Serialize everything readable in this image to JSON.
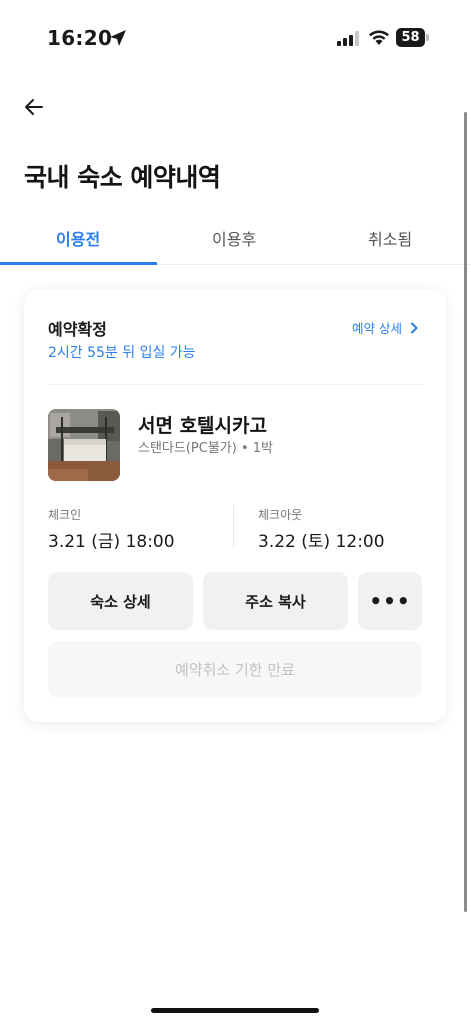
{
  "status_bar": {
    "time": "16:20",
    "battery": "58",
    "icons": [
      "location-arrow-icon",
      "signal-icon",
      "wifi-icon",
      "battery-icon"
    ]
  },
  "header": {
    "back_icon": "arrow-left-icon",
    "title": "국내 숙소 예약내역"
  },
  "tabs": [
    {
      "label": "이용전",
      "active": true
    },
    {
      "label": "이용후",
      "active": false
    },
    {
      "label": "취소됨",
      "active": false
    }
  ],
  "reservation": {
    "status": "예약확정",
    "time_remaining": "2시간 55분 뒤 입실 가능",
    "detail_link": "예약 상세",
    "hotel_name": "서면 호텔시카고",
    "room_info": "스탠다드(PC불가) • 1박",
    "checkin_label": "체크인",
    "checkin_value": "3.21 (금) 18:00",
    "checkout_label": "체크아웃",
    "checkout_value": "3.22 (토) 12:00",
    "buttons": {
      "detail": "숙소 상세",
      "copy_address": "주소 복사",
      "more": "•••",
      "cancel": "예약취소 기한 만료"
    }
  },
  "colors": {
    "accent": "#2a7ff0",
    "button_bg": "#f1f1f1",
    "disabled_text": "#c2c2c2"
  }
}
